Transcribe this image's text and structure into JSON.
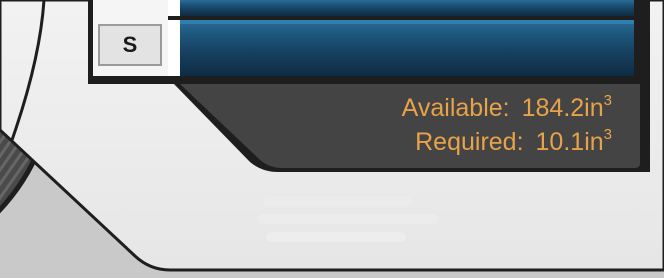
{
  "button": {
    "label": "S"
  },
  "volume": {
    "available_label": "Available:",
    "available_value": "184.2in",
    "available_unit_exp": "3",
    "required_label": "Required:",
    "required_value": "10.1in",
    "required_unit_exp": "3"
  },
  "colors": {
    "readout_text": "#e8a24a",
    "info_panel": "#444444",
    "bar_dark": "#163a55",
    "bar_mid": "#1f5a80",
    "frame": "#1e1e1e",
    "panel_light": "#f0f0f0"
  }
}
